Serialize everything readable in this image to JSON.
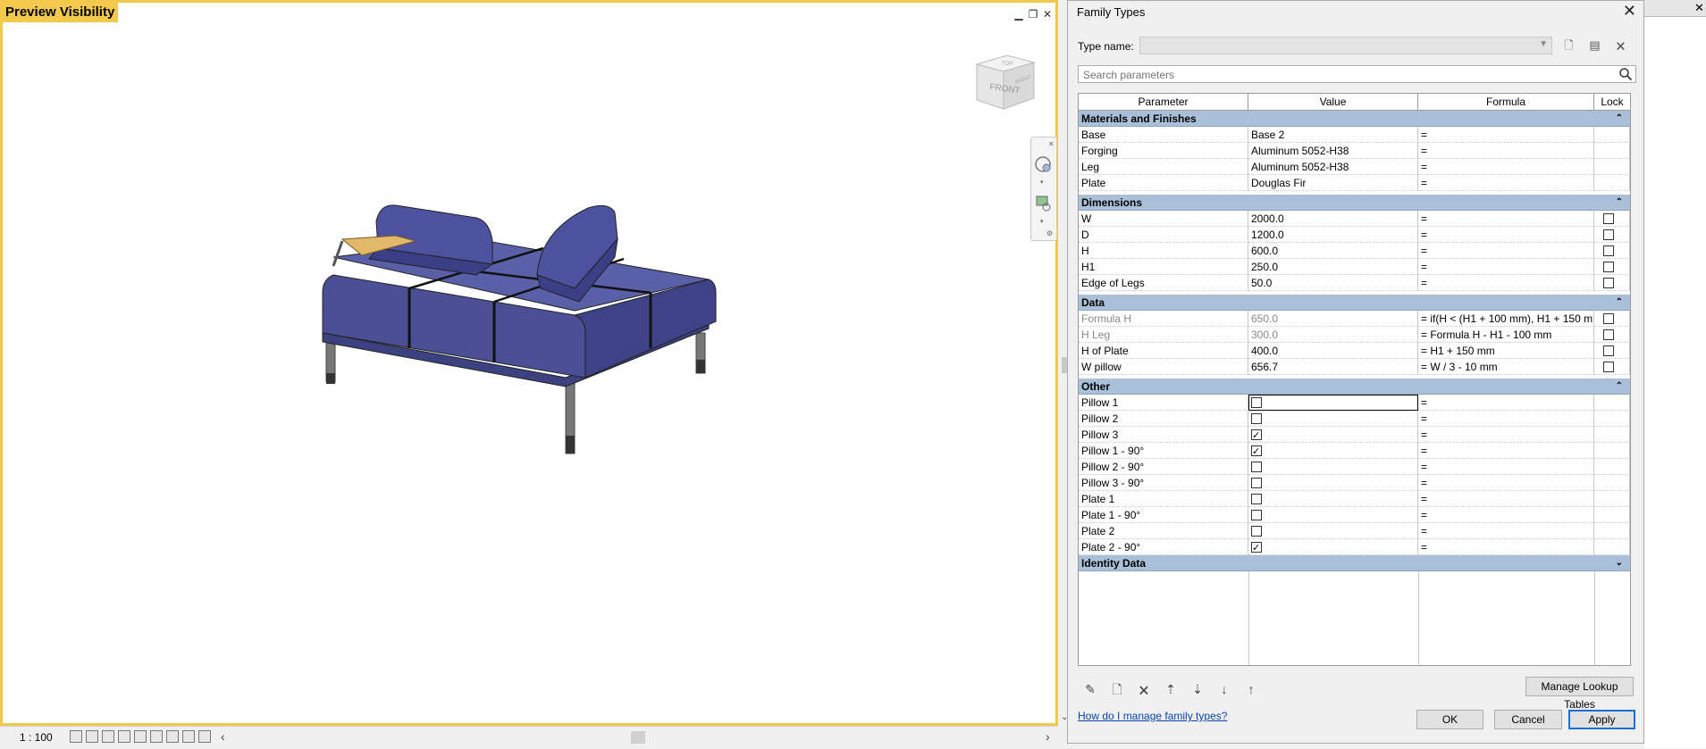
{
  "viewport": {
    "label": "Preview Visibility",
    "viewcube_front": "FRONT",
    "viewcube_top": "TOP",
    "viewcube_right": "RIGHT",
    "scale": "1 : 100"
  },
  "dialog": {
    "title": "Family Types",
    "type_name_label": "Type name:",
    "type_name_value": "",
    "search_placeholder": "Search parameters",
    "columns": [
      "Parameter",
      "Value",
      "Formula",
      "Lock"
    ],
    "groups": {
      "materials": {
        "label": "Materials and Finishes",
        "rows": [
          {
            "param": "Base",
            "value": "Base 2",
            "formula": "="
          },
          {
            "param": "Forging",
            "value": "Aluminum 5052-H38",
            "formula": "="
          },
          {
            "param": "Leg",
            "value": "Aluminum 5052-H38",
            "formula": "="
          },
          {
            "param": "Plate",
            "value": "Douglas Fir",
            "formula": "="
          }
        ]
      },
      "dimensions": {
        "label": "Dimensions",
        "rows": [
          {
            "param": "W",
            "value": "2000.0",
            "formula": "="
          },
          {
            "param": "D",
            "value": "1200.0",
            "formula": "="
          },
          {
            "param": "H",
            "value": "600.0",
            "formula": "="
          },
          {
            "param": "H1",
            "value": "250.0",
            "formula": "="
          },
          {
            "param": "Edge of Legs",
            "value": "50.0",
            "formula": "="
          }
        ]
      },
      "data": {
        "label": "Data",
        "rows": [
          {
            "param": "Formula H",
            "value": "650.0",
            "formula": "= if(H < (H1 + 100 mm), H1 + 150 m"
          },
          {
            "param": "H Leg",
            "value": "300.0",
            "formula": "= Formula H - H1 - 100 mm"
          },
          {
            "param": "H of Plate",
            "value": "400.0",
            "formula": "= H1 + 150 mm"
          },
          {
            "param": "W pillow",
            "value": "656.7",
            "formula": "= W / 3 - 10 mm"
          }
        ]
      },
      "other": {
        "label": "Other",
        "rows": [
          {
            "param": "Pillow 1",
            "checked": false,
            "formula": "="
          },
          {
            "param": "Pillow 2",
            "checked": false,
            "formula": "="
          },
          {
            "param": "Pillow 3",
            "checked": true,
            "formula": "="
          },
          {
            "param": "Pillow 1 - 90°",
            "checked": true,
            "formula": "="
          },
          {
            "param": "Pillow 2 - 90°",
            "checked": false,
            "formula": "="
          },
          {
            "param": "Pillow 3 - 90°",
            "checked": false,
            "formula": "="
          },
          {
            "param": "Plate 1",
            "checked": false,
            "formula": "="
          },
          {
            "param": "Plate 1 - 90°",
            "checked": false,
            "formula": "="
          },
          {
            "param": "Plate 2",
            "checked": false,
            "formula": "="
          },
          {
            "param": "Plate 2 - 90°",
            "checked": true,
            "formula": "="
          }
        ]
      },
      "identity": {
        "label": "Identity Data"
      }
    },
    "manage_lookup_label": "Manage Lookup Tables",
    "help_link": "How do I manage family types?",
    "ok_label": "OK",
    "cancel_label": "Cancel",
    "apply_label": "Apply"
  },
  "colors": {
    "viewport_border": "#f2c94c",
    "group_header": "#a9c0d8",
    "sofa": "#4a4f96",
    "plate": "#e2b86a",
    "apply_border": "#1a6fd6"
  }
}
